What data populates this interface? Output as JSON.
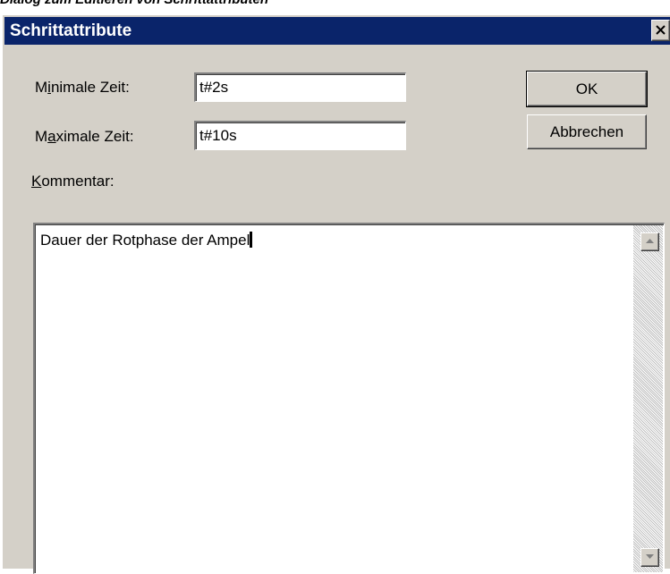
{
  "caption": "Dialog zum Editieren von Schrittattributen",
  "window": {
    "title": "Schrittattribute",
    "close_symbol": "×"
  },
  "fields": {
    "min_time": {
      "label": "Minimale Zeit:",
      "accesskey": "i",
      "value": "t#2s"
    },
    "max_time": {
      "label": "Maximale Zeit:",
      "accesskey": "a",
      "value": "t#10s"
    }
  },
  "comment": {
    "label": "Kommentar:",
    "accesskey": "K",
    "value": "Dauer der Rotphase der Ampel"
  },
  "buttons": {
    "ok": "OK",
    "cancel": "Abbrechen"
  },
  "colors": {
    "titlebar": "#0a246a",
    "dialog_bg": "#d4d0c8"
  },
  "icons": {
    "close": "close-icon",
    "scroll_up": "arrow-up-icon",
    "scroll_down": "arrow-down-icon"
  }
}
